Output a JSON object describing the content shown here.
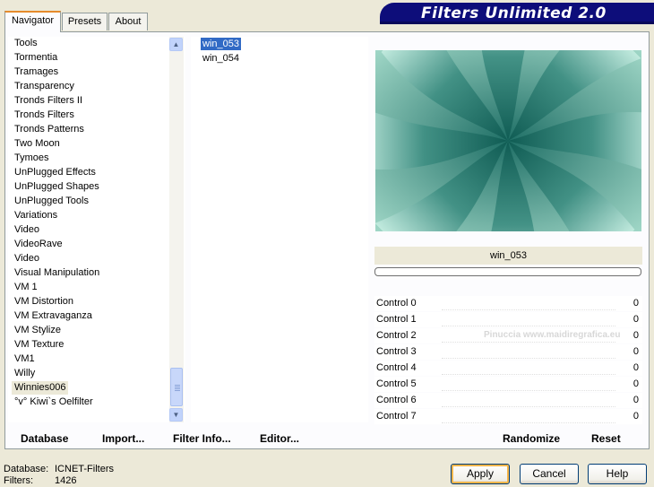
{
  "tabs": [
    {
      "label": "Navigator",
      "active": true
    },
    {
      "label": "Presets",
      "active": false
    },
    {
      "label": "About",
      "active": false
    }
  ],
  "title": "Filters Unlimited 2.0",
  "categories": [
    "Tools",
    "Tormentia",
    "Tramages",
    "Transparency",
    "Tronds Filters II",
    "Tronds Filters",
    "Tronds Patterns",
    "Two Moon",
    "Tymoes",
    "UnPlugged Effects",
    "UnPlugged Shapes",
    "UnPlugged Tools",
    "Variations",
    "Video",
    "VideoRave",
    "Video",
    "Visual Manipulation",
    "VM 1",
    "VM Distortion",
    "VM Extravaganza",
    "VM Stylize",
    "VM Texture",
    "VM1",
    "Willy",
    "Winnies006",
    "°v° Kiwi`s Oelfilter"
  ],
  "selected_category_index": 24,
  "filters": [
    {
      "label": "win_053",
      "selected": true
    },
    {
      "label": "win_054",
      "selected": false
    }
  ],
  "preview_name": "win_053",
  "progress_fraction": 0,
  "controls": [
    {
      "label": "Control 0",
      "value": "0"
    },
    {
      "label": "Control 1",
      "value": "0"
    },
    {
      "label": "Control 2",
      "value": "0"
    },
    {
      "label": "Control 3",
      "value": "0"
    },
    {
      "label": "Control 4",
      "value": "0"
    },
    {
      "label": "Control 5",
      "value": "0"
    },
    {
      "label": "Control 6",
      "value": "0"
    },
    {
      "label": "Control 7",
      "value": "0"
    }
  ],
  "bottom_links": {
    "database": "Database",
    "import": "Import...",
    "filter_info": "Filter Info...",
    "editor": "Editor...",
    "randomize": "Randomize",
    "reset": "Reset"
  },
  "status": {
    "database_label": "Database:",
    "database_value": "ICNET-Filters",
    "filters_label": "Filters:",
    "filters_value": "1426"
  },
  "buttons": {
    "apply": "Apply",
    "cancel": "Cancel",
    "help": "Help"
  },
  "watermark": "Pinuccia www.maidiregrafica.eu",
  "colors": {
    "title_banner": "#0d0d7a",
    "selection": "#316ac5",
    "preview_dark": "#0e5a52",
    "preview_light": "#b8e6d8"
  }
}
